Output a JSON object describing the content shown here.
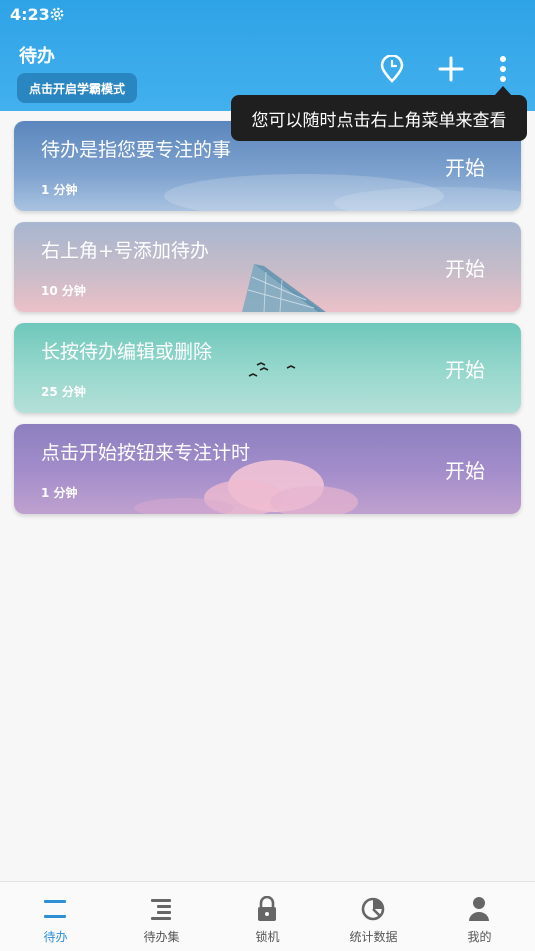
{
  "status_bar": {
    "time": "4:23",
    "settings_icon": "gear-icon"
  },
  "header": {
    "title": "待办",
    "mode_button": "点击开启学霸模式",
    "icons": [
      "location-icon",
      "add-icon",
      "more-vertical-icon"
    ]
  },
  "tooltip": {
    "text": "您可以随时点击右上角菜单来查看"
  },
  "todos": [
    {
      "title": "待办是指您要专注的事",
      "duration": "1 分钟",
      "action": "开始"
    },
    {
      "title": "右上角+号添加待办",
      "duration": "10 分钟",
      "action": "开始"
    },
    {
      "title": "长按待办编辑或删除",
      "duration": "25 分钟",
      "action": "开始"
    },
    {
      "title": "点击开始按钮来专注计时",
      "duration": "1 分钟",
      "action": "开始"
    }
  ],
  "bottom_nav": {
    "items": [
      {
        "label": "待办",
        "icon": "todo-list-icon",
        "active": true
      },
      {
        "label": "待办集",
        "icon": "todo-collection-icon",
        "active": false
      },
      {
        "label": "锁机",
        "icon": "lock-icon",
        "active": false
      },
      {
        "label": "统计数据",
        "icon": "pie-chart-icon",
        "active": false
      },
      {
        "label": "我的",
        "icon": "person-icon",
        "active": false
      }
    ]
  },
  "colors": {
    "header": "#2ea3e6",
    "accent": "#2e8fd6",
    "tooltip": "#1f1f1f"
  }
}
